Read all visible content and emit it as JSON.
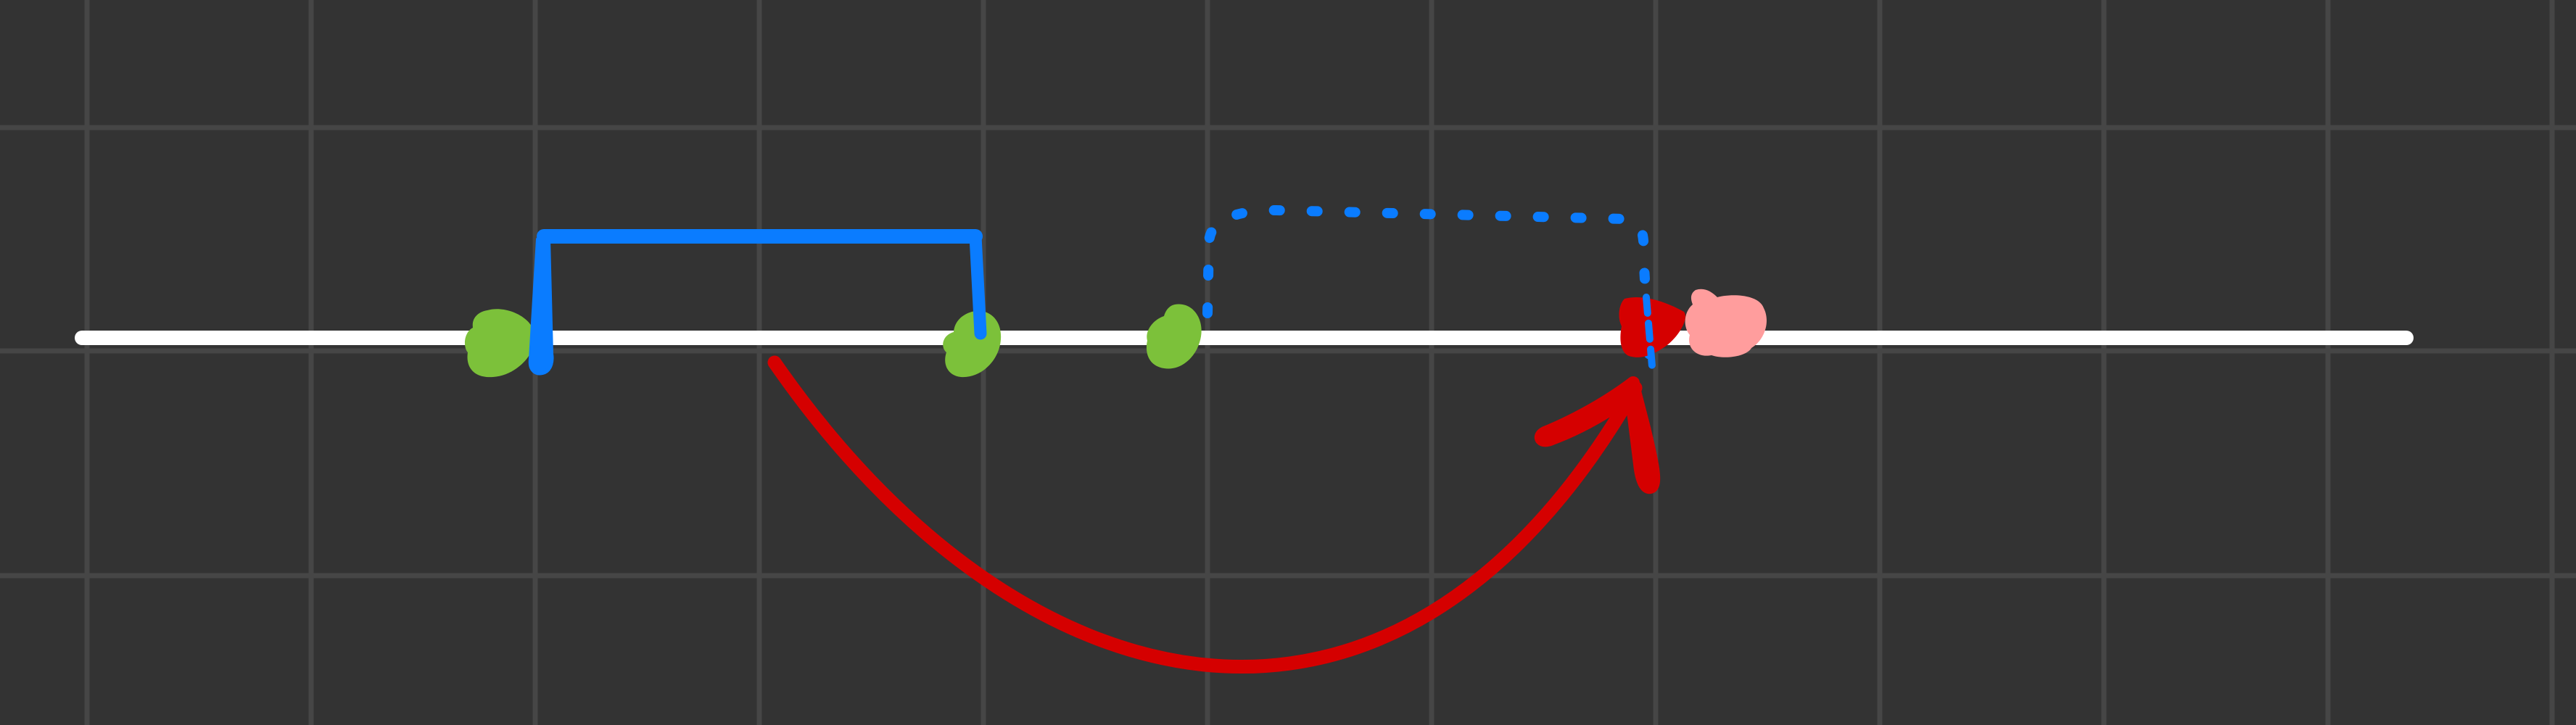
{
  "canvas": {
    "background": "#333333",
    "grid_color": "#464646"
  },
  "colors": {
    "timeline": "#ffffff",
    "note_marker": "#7cc13a",
    "bracket": "#0a7cff",
    "arc_arrow": "#d50000",
    "current_marker": "#d50000",
    "target_marker": "#ff9d9d"
  },
  "diagram": {
    "elements": [
      {
        "name": "timeline-line",
        "kind": "line",
        "color": "timeline"
      },
      {
        "name": "note-marker-1",
        "kind": "blob",
        "color": "note_marker"
      },
      {
        "name": "note-marker-2",
        "kind": "blob",
        "color": "note_marker"
      },
      {
        "name": "note-marker-3",
        "kind": "blob",
        "color": "note_marker"
      },
      {
        "name": "solid-bracket",
        "kind": "bracket",
        "color": "bracket"
      },
      {
        "name": "dotted-bracket",
        "kind": "dotted-path",
        "color": "bracket"
      },
      {
        "name": "red-arc-arrow",
        "kind": "arrow",
        "color": "arc_arrow"
      },
      {
        "name": "current-position-marker",
        "kind": "blob",
        "color": "current_marker"
      },
      {
        "name": "target-position-marker",
        "kind": "blob",
        "color": "target_marker"
      }
    ]
  }
}
